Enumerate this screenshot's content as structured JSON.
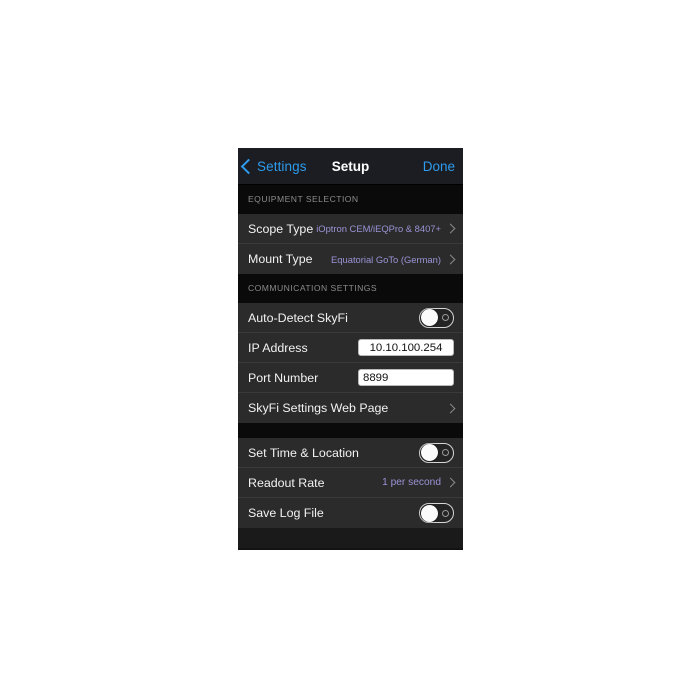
{
  "navbar": {
    "back_label": "Settings",
    "back_icon": "chevron-left-icon",
    "title": "Setup",
    "done_label": "Done"
  },
  "colors": {
    "accent_blue": "#2e9bec",
    "value_purple": "#9b93d6",
    "row_background": "#2b2b2b",
    "section_background": "#0a0a0a",
    "navbar_background": "#1b1d22"
  },
  "sections": [
    {
      "header": "EQUIPMENT SELECTION",
      "rows": [
        {
          "label": "Scope Type",
          "value": "iOptron CEM/iEQPro & 8407+",
          "accessory": "chevron-right-icon"
        },
        {
          "label": "Mount Type",
          "value": "Equatorial GoTo (German)",
          "accessory": "chevron-right-icon"
        }
      ]
    },
    {
      "header": "COMMUNICATION SETTINGS",
      "rows": [
        {
          "label": "Auto-Detect SkyFi",
          "accessory": "toggle-switch",
          "toggle_state": "off"
        },
        {
          "label": "IP Address",
          "accessory": "text-input",
          "input_value": "10.10.100.254",
          "input_placeholder": "IP Address"
        },
        {
          "label": "Port Number",
          "accessory": "text-input",
          "input_value": "8899",
          "input_placeholder": "Port"
        },
        {
          "label": "SkyFi Settings Web Page",
          "value": "",
          "accessory": "chevron-right-icon"
        }
      ]
    },
    {
      "header": "",
      "rows": [
        {
          "label": "Set Time & Location",
          "accessory": "toggle-switch",
          "toggle_state": "off"
        },
        {
          "label": "Readout Rate",
          "value": "1 per second",
          "accessory": "chevron-right-icon"
        },
        {
          "label": "Save Log File",
          "accessory": "toggle-switch",
          "toggle_state": "off"
        }
      ]
    }
  ]
}
